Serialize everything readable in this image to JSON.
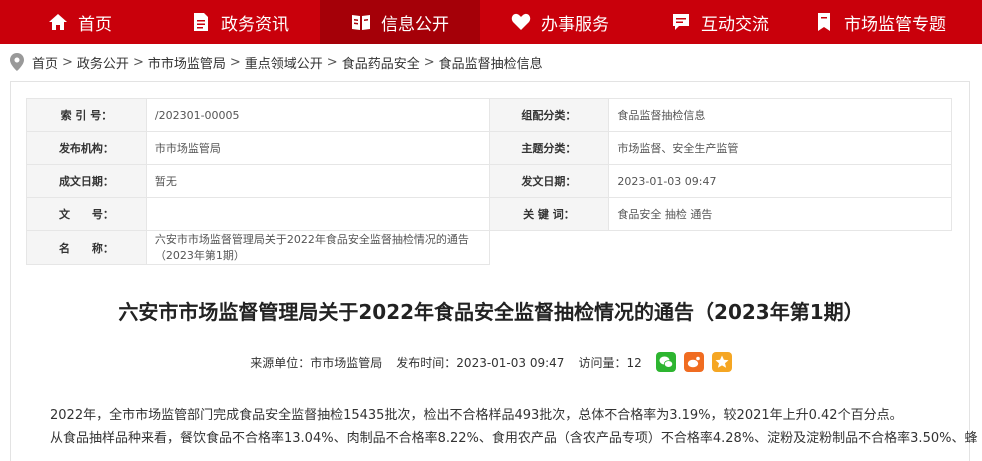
{
  "nav": {
    "items": [
      {
        "label": "首页",
        "icon": "home-icon"
      },
      {
        "label": "政务资讯",
        "icon": "document-icon"
      },
      {
        "label": "信息公开",
        "icon": "book-icon"
      },
      {
        "label": "办事服务",
        "icon": "heart-icon"
      },
      {
        "label": "互动交流",
        "icon": "chat-icon"
      },
      {
        "label": "市场监管专题",
        "icon": "bookmark-icon"
      }
    ],
    "active_index": 2,
    "color": "#c9000b",
    "active_color": "#a50008"
  },
  "breadcrumb": {
    "items": [
      "首页",
      "政务公开",
      "市市场监管局",
      "重点领域公开",
      "食品药品安全",
      "食品监督抽检信息"
    ],
    "separator": ">"
  },
  "meta": {
    "index_label": "索 引 号：",
    "index_value": "/202301-00005",
    "category_label": "组配分类：",
    "category_value": "食品监督抽检信息",
    "publisher_label": "发布机构：",
    "publisher_value": "市市场监管局",
    "topic_label": "主题分类：",
    "topic_value": "市场监督、安全生产监管",
    "created_label": "成文日期：",
    "created_value": "暂无",
    "issued_label": "发文日期：",
    "issued_value": "2023-01-03 09:47",
    "docno_label": "文　　号：",
    "docno_value": "",
    "keywords_label": "关 键 词：",
    "keywords_value": "食品安全 抽检 通告",
    "name_label": "名　　称：",
    "name_value_line1": "六安市市场监督管理局关于2022年食品安全监督抽检情况的通告",
    "name_value_line2": "（2023年第1期）"
  },
  "article": {
    "title": "六安市市场监督管理局关于2022年食品安全监督抽检情况的通告（2023年第1期）",
    "source_label": "来源单位：市市场监管局",
    "time_label": "发布时间：2023-01-03 09:47",
    "views_label": "访问量：12",
    "paragraph1": "2022年，全市市场监管部门完成食品安全监督抽检15435批次，检出不合格样品493批次，总体不合格率为3.19%，较2021年上升0.42个百分点。",
    "paragraph2": "从食品抽样品种来看，餐饮食品不合格率13.04%、肉制品不合格率8.22%、食用农产品（含农产品专项）不合格率4.28%、淀粉及淀粉制品不合格率3.50%、蜂"
  },
  "share": {
    "wechat_color": "#2db530",
    "weibo_color": "#f06c21",
    "favorite_color": "#f5a623"
  }
}
